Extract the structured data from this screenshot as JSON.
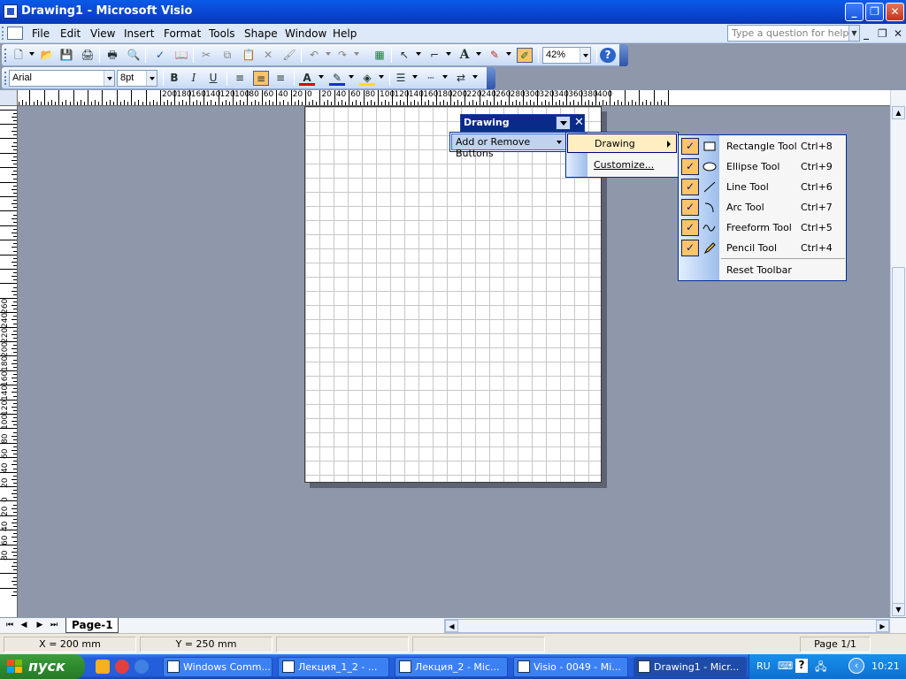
{
  "window": {
    "title": "Drawing1 - Microsoft Visio"
  },
  "menu": {
    "items": [
      "File",
      "Edit",
      "View",
      "Insert",
      "Format",
      "Tools",
      "Shape",
      "Window",
      "Help"
    ],
    "help_placeholder": "Type a question for help"
  },
  "format_toolbar": {
    "font": "Arial",
    "size": "8pt"
  },
  "standard_toolbar": {
    "zoom": "42%"
  },
  "ruler": {
    "h_labels": [
      "200",
      "180",
      "160",
      "140",
      "120",
      "100",
      "80",
      "60",
      "40",
      "20",
      "0",
      "20",
      "40",
      "60",
      "80",
      "100",
      "120",
      "140",
      "160",
      "180",
      "200",
      "220",
      "240",
      "260",
      "280",
      "300",
      "320",
      "340",
      "360",
      "380",
      "400"
    ],
    "v_labels": [
      "260",
      "240",
      "220",
      "200",
      "180",
      "160",
      "140",
      "120",
      "100",
      "80",
      "60",
      "40",
      "20",
      "0",
      "20",
      "40",
      "60",
      "80"
    ]
  },
  "drawing_toolbar": {
    "title": "Drawing",
    "add_remove": "Add or Remove Buttons",
    "submenu": {
      "drawing": "Drawing",
      "customize": "Customize..."
    },
    "tools": [
      {
        "label": "Rectangle Tool",
        "shortcut": "Ctrl+8",
        "icon": "rectangle-icon"
      },
      {
        "label": "Ellipse Tool",
        "shortcut": "Ctrl+9",
        "icon": "ellipse-icon"
      },
      {
        "label": "Line Tool",
        "shortcut": "Ctrl+6",
        "icon": "line-icon"
      },
      {
        "label": "Arc Tool",
        "shortcut": "Ctrl+7",
        "icon": "arc-icon"
      },
      {
        "label": "Freeform Tool",
        "shortcut": "Ctrl+5",
        "icon": "freeform-icon"
      },
      {
        "label": "Pencil Tool",
        "shortcut": "Ctrl+4",
        "icon": "pencil-icon"
      }
    ],
    "reset": "Reset Toolbar"
  },
  "pagetab": {
    "label": "Page-1"
  },
  "status": {
    "x": "X = 200 mm",
    "y": "Y = 250 mm",
    "page": "Page 1/1"
  },
  "taskbar": {
    "start": "пуск",
    "tasks": [
      "Windows Comm...",
      "Лекция_1_2 - ...",
      "Лекция_2 - Mic...",
      "Visio - 0049 - Mi...",
      "Drawing1 - Micr..."
    ],
    "lang": "RU",
    "clock": "10:21"
  },
  "colors": {
    "accent": "#0a246a",
    "highlight": "#ffc36a",
    "canvas": "#8f98aa"
  }
}
